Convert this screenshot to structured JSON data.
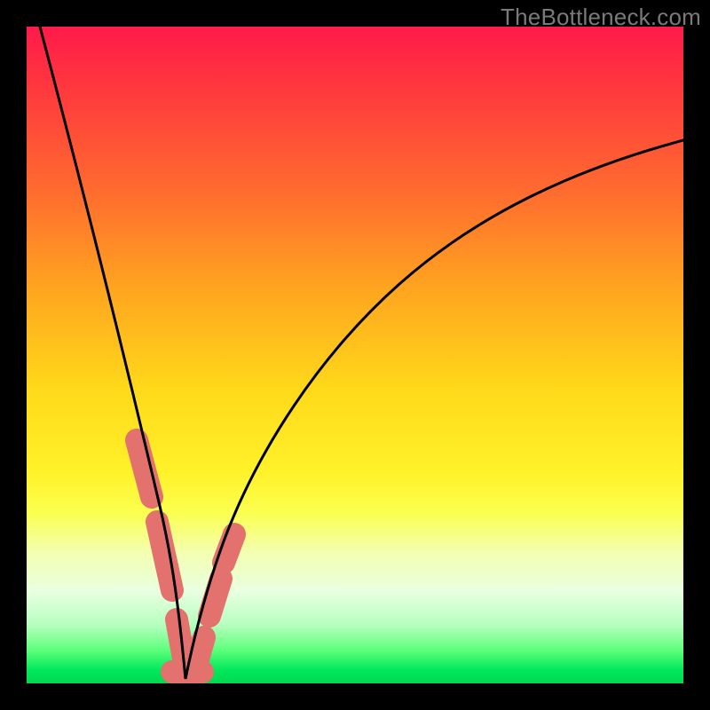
{
  "watermark": "TheBottleneck.com",
  "colors": {
    "frame": "#000000",
    "curve": "#000000",
    "highlight": "#e3716d",
    "gradient_top": "#ff1a4a",
    "gradient_bottom": "#00d850"
  },
  "chart_data": {
    "type": "line",
    "title": "",
    "xlabel": "",
    "ylabel": "",
    "xlim": [
      0,
      100
    ],
    "ylim": [
      0,
      100
    ],
    "x": [
      0,
      5,
      10,
      15,
      17,
      19,
      20.5,
      22,
      23,
      23.7,
      24.5,
      26,
      28,
      30,
      33,
      38,
      45,
      55,
      65,
      75,
      85,
      95,
      100
    ],
    "values": [
      100,
      83,
      65,
      47,
      37,
      27,
      18,
      10,
      4.5,
      1.5,
      0.3,
      1.5,
      5.5,
      11,
      20,
      33,
      46,
      58,
      66,
      72,
      77,
      81,
      83
    ],
    "minimum_x": 24.2,
    "highlighted_segments_x": [
      [
        16.8,
        19.0
      ],
      [
        19.8,
        22.2
      ],
      [
        22.8,
        24.0
      ],
      [
        24.2,
        25.6
      ],
      [
        25.8,
        27.0
      ],
      [
        27.8,
        29.6
      ],
      [
        30.0,
        31.6
      ]
    ],
    "bottom_highlight_x": [
      22.2,
      26.8
    ]
  }
}
